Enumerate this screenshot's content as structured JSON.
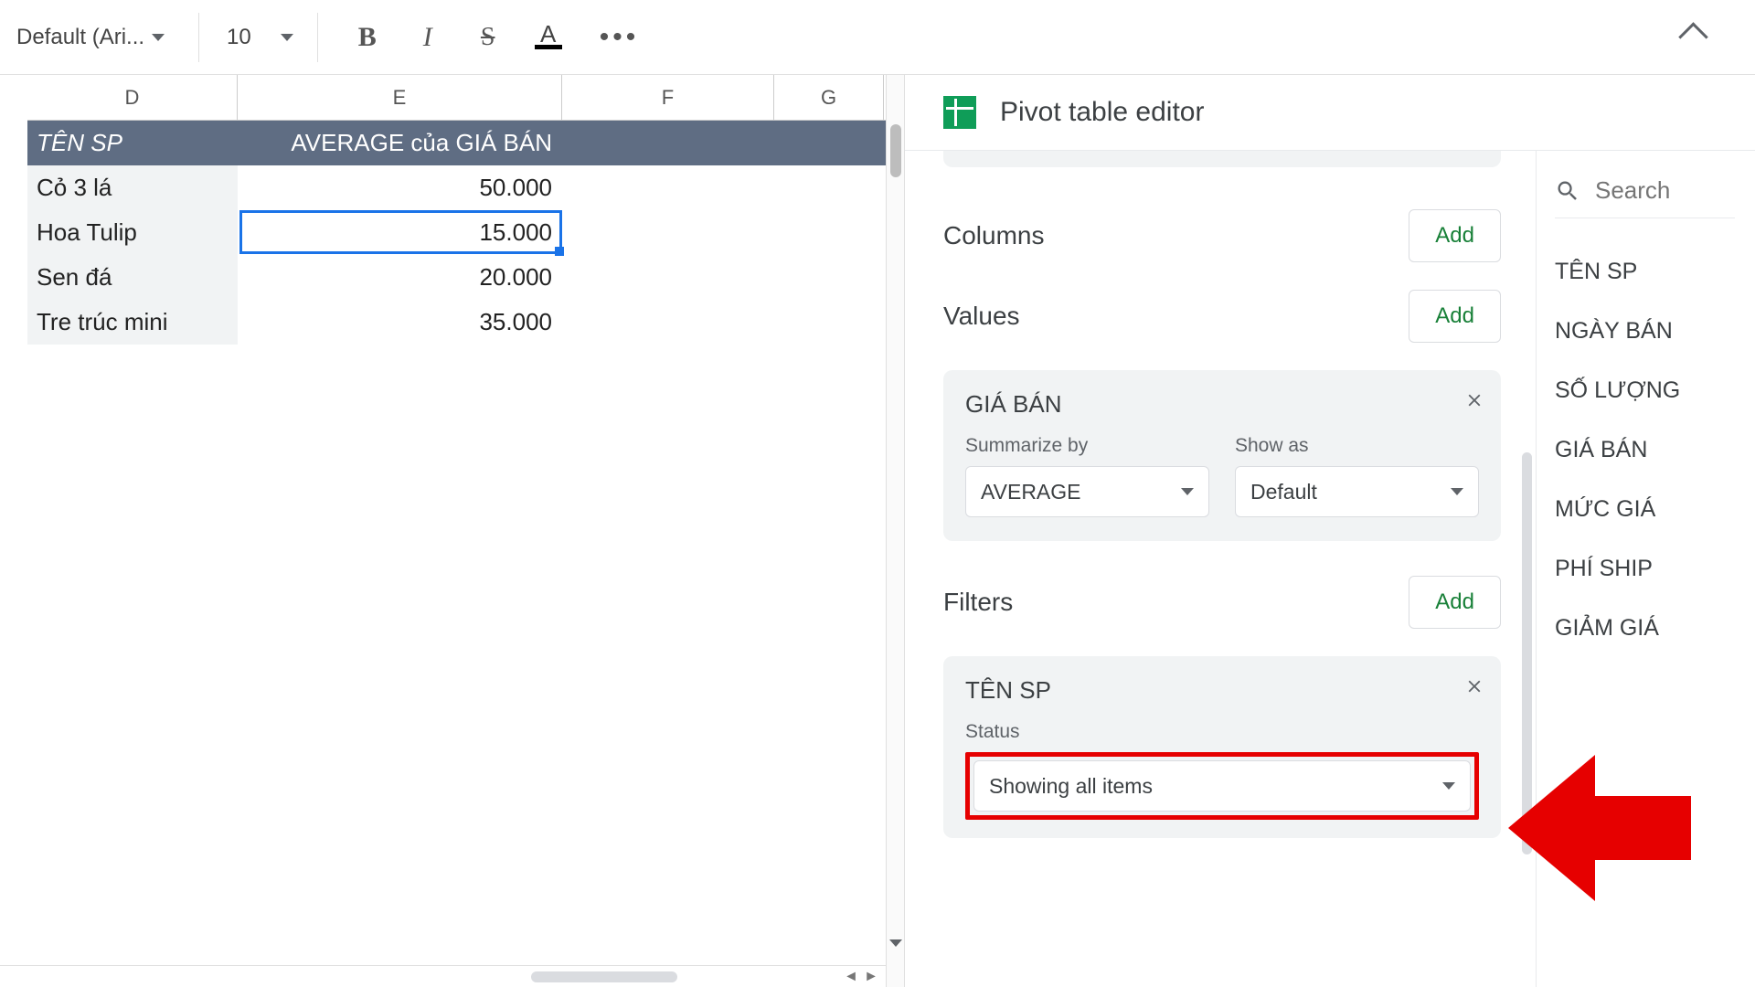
{
  "toolbar": {
    "font": "Default (Ari...",
    "size": "10"
  },
  "sheet": {
    "columns": [
      "D",
      "E",
      "F",
      "G"
    ],
    "header_row": {
      "d": "TÊN SP",
      "e": "AVERAGE của GIÁ BÁN"
    },
    "rows": [
      {
        "d": "Cỏ 3 lá",
        "e": "50.000"
      },
      {
        "d": "Hoa Tulip",
        "e": "15.000"
      },
      {
        "d": "Sen đá",
        "e": "20.000"
      },
      {
        "d": "Tre trúc mini",
        "e": "35.000"
      }
    ],
    "selected_cell_value": "15.000"
  },
  "editor": {
    "title": "Pivot table editor",
    "sections": {
      "columns": {
        "label": "Columns",
        "add": "Add"
      },
      "values": {
        "label": "Values",
        "add": "Add"
      },
      "filters": {
        "label": "Filters",
        "add": "Add"
      }
    },
    "value_card": {
      "title": "GIÁ BÁN",
      "summarize_label": "Summarize by",
      "summarize_value": "AVERAGE",
      "showas_label": "Show as",
      "showas_value": "Default"
    },
    "filter_card": {
      "title": "TÊN SP",
      "status_label": "Status",
      "status_value": "Showing all items"
    },
    "search_placeholder": "Search",
    "fields": [
      "TÊN SP",
      "NGÀY BÁN",
      "SỐ LƯỢNG",
      "GIÁ BÁN",
      "MỨC GIÁ",
      "PHÍ SHIP",
      "GIẢM GIÁ"
    ]
  }
}
